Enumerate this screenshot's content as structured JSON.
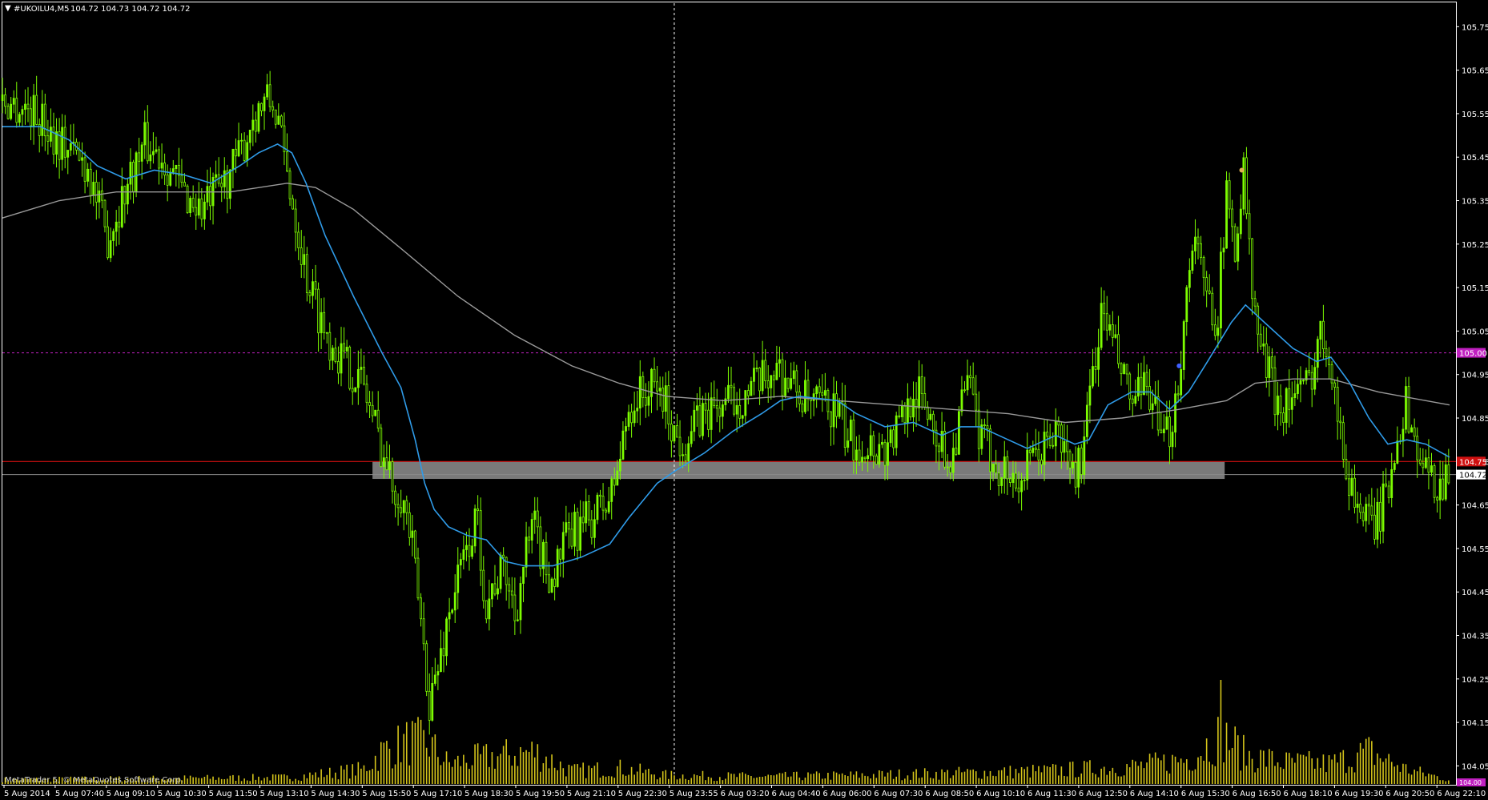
{
  "header": {
    "symbol_line": "#UKOILU4,M5",
    "ohlc": "104.72 104.73 104.72 104.72"
  },
  "footer": {
    "copyright": "MetaTrader 5, © MetaQuotes Software Corp."
  },
  "colors": {
    "background": "#000000",
    "candle": "#7CFC00",
    "volume": "#D4C41A",
    "ma_fast": "#2F9BE8",
    "ma_slow": "#9A9A9A",
    "resistance": "#C020C0",
    "support": "#D01010",
    "zone": "#7A7A7A",
    "bid_line": "#8A8A8A",
    "axis": "#FFFFFF"
  },
  "chart_data": {
    "type": "candlestick",
    "ylim": [
      104.0,
      105.8
    ],
    "y_ticks": [
      "105.75",
      "105.65",
      "105.55",
      "105.45",
      "105.35",
      "105.25",
      "105.15",
      "105.05",
      "104.95",
      "104.85",
      "104.75",
      "104.65",
      "104.55",
      "104.45",
      "104.35",
      "104.25",
      "104.15",
      "104.05"
    ],
    "x_ticks": [
      "5 Aug 2014",
      "5 Aug 07:40",
      "5 Aug 09:10",
      "5 Aug 10:30",
      "5 Aug 11:50",
      "5 Aug 13:10",
      "5 Aug 14:30",
      "5 Aug 15:50",
      "5 Aug 17:10",
      "5 Aug 18:30",
      "5 Aug 19:50",
      "5 Aug 21:10",
      "5 Aug 22:30",
      "5 Aug 23:55",
      "6 Aug 03:20",
      "6 Aug 04:40",
      "6 Aug 06:00",
      "6 Aug 07:30",
      "6 Aug 08:50",
      "6 Aug 10:10",
      "6 Aug 11:30",
      "6 Aug 12:50",
      "6 Aug 14:10",
      "6 Aug 15:30",
      "6 Aug 16:50",
      "6 Aug 18:10",
      "6 Aug 19:30",
      "6 Aug 20:50",
      "6 Aug 22:10"
    ],
    "price_path": [
      [
        0,
        105.58
      ],
      [
        30,
        105.56
      ],
      [
        60,
        105.49
      ],
      [
        90,
        105.43
      ],
      [
        110,
        105.26
      ],
      [
        130,
        105.38
      ],
      [
        150,
        105.48
      ],
      [
        170,
        105.45
      ],
      [
        190,
        105.37
      ],
      [
        210,
        105.33
      ],
      [
        230,
        105.38
      ],
      [
        250,
        105.45
      ],
      [
        265,
        105.55
      ],
      [
        280,
        105.58
      ],
      [
        290,
        105.55
      ],
      [
        295,
        105.46
      ],
      [
        305,
        105.36
      ],
      [
        320,
        105.18
      ],
      [
        340,
        105.05
      ],
      [
        360,
        104.98
      ],
      [
        380,
        104.93
      ],
      [
        400,
        104.78
      ],
      [
        410,
        104.7
      ],
      [
        420,
        104.68
      ],
      [
        430,
        104.58
      ],
      [
        440,
        104.4
      ],
      [
        450,
        104.2
      ],
      [
        460,
        104.28
      ],
      [
        470,
        104.4
      ],
      [
        480,
        104.48
      ],
      [
        490,
        104.55
      ],
      [
        500,
        104.62
      ],
      [
        510,
        104.42
      ],
      [
        520,
        104.48
      ],
      [
        530,
        104.5
      ],
      [
        540,
        104.4
      ],
      [
        550,
        104.52
      ],
      [
        560,
        104.6
      ],
      [
        570,
        104.52
      ],
      [
        580,
        104.48
      ],
      [
        590,
        104.55
      ],
      [
        600,
        104.58
      ],
      [
        620,
        104.62
      ],
      [
        640,
        104.66
      ],
      [
        650,
        104.75
      ],
      [
        660,
        104.87
      ],
      [
        670,
        104.9
      ],
      [
        690,
        104.92
      ],
      [
        700,
        104.88
      ],
      [
        710,
        104.8
      ],
      [
        720,
        104.8
      ],
      [
        740,
        104.86
      ],
      [
        760,
        104.88
      ],
      [
        780,
        104.9
      ],
      [
        800,
        104.93
      ],
      [
        815,
        104.97
      ],
      [
        830,
        104.93
      ],
      [
        850,
        104.88
      ],
      [
        880,
        104.87
      ],
      [
        890,
        104.8
      ],
      [
        910,
        104.79
      ],
      [
        930,
        104.78
      ],
      [
        950,
        104.85
      ],
      [
        960,
        104.92
      ],
      [
        980,
        104.85
      ],
      [
        990,
        104.78
      ],
      [
        1000,
        104.75
      ],
      [
        1010,
        104.88
      ],
      [
        1020,
        104.92
      ],
      [
        1030,
        104.8
      ],
      [
        1050,
        104.74
      ],
      [
        1070,
        104.7
      ],
      [
        1090,
        104.76
      ],
      [
        1110,
        104.82
      ],
      [
        1130,
        104.72
      ],
      [
        1140,
        104.78
      ],
      [
        1150,
        104.98
      ],
      [
        1160,
        105.1
      ],
      [
        1170,
        105.02
      ],
      [
        1190,
        104.88
      ],
      [
        1210,
        104.92
      ],
      [
        1220,
        104.78
      ],
      [
        1230,
        104.82
      ],
      [
        1240,
        104.95
      ],
      [
        1255,
        105.3
      ],
      [
        1265,
        105.15
      ],
      [
        1280,
        105.08
      ],
      [
        1290,
        105.35
      ],
      [
        1300,
        105.25
      ],
      [
        1308,
        105.42
      ],
      [
        1318,
        105.1
      ],
      [
        1330,
        104.98
      ],
      [
        1345,
        104.88
      ],
      [
        1360,
        104.9
      ],
      [
        1375,
        104.92
      ],
      [
        1390,
        105.05
      ],
      [
        1400,
        105.0
      ],
      [
        1410,
        104.8
      ],
      [
        1420,
        104.7
      ],
      [
        1440,
        104.6
      ],
      [
        1450,
        104.62
      ],
      [
        1460,
        104.68
      ],
      [
        1470,
        104.83
      ],
      [
        1480,
        104.88
      ],
      [
        1490,
        104.78
      ],
      [
        1500,
        104.72
      ],
      [
        1510,
        104.7
      ],
      [
        1525,
        104.72
      ]
    ],
    "ma_fast_path": [
      [
        0,
        105.52
      ],
      [
        40,
        105.52
      ],
      [
        70,
        105.49
      ],
      [
        100,
        105.43
      ],
      [
        130,
        105.4
      ],
      [
        160,
        105.42
      ],
      [
        190,
        105.41
      ],
      [
        220,
        105.39
      ],
      [
        250,
        105.43
      ],
      [
        270,
        105.46
      ],
      [
        290,
        105.48
      ],
      [
        305,
        105.46
      ],
      [
        320,
        105.39
      ],
      [
        340,
        105.27
      ],
      [
        370,
        105.13
      ],
      [
        400,
        105.0
      ],
      [
        420,
        104.92
      ],
      [
        435,
        104.8
      ],
      [
        445,
        104.7
      ],
      [
        455,
        104.64
      ],
      [
        470,
        104.6
      ],
      [
        490,
        104.58
      ],
      [
        510,
        104.57
      ],
      [
        530,
        104.52
      ],
      [
        550,
        104.51
      ],
      [
        580,
        104.51
      ],
      [
        610,
        104.53
      ],
      [
        640,
        104.56
      ],
      [
        660,
        104.62
      ],
      [
        690,
        104.7
      ],
      [
        710,
        104.73
      ],
      [
        740,
        104.77
      ],
      [
        770,
        104.82
      ],
      [
        800,
        104.86
      ],
      [
        820,
        104.89
      ],
      [
        840,
        104.9
      ],
      [
        880,
        104.89
      ],
      [
        900,
        104.86
      ],
      [
        930,
        104.83
      ],
      [
        960,
        104.84
      ],
      [
        990,
        104.81
      ],
      [
        1010,
        104.83
      ],
      [
        1030,
        104.83
      ],
      [
        1060,
        104.8
      ],
      [
        1080,
        104.78
      ],
      [
        1110,
        104.81
      ],
      [
        1130,
        104.79
      ],
      [
        1145,
        104.8
      ],
      [
        1165,
        104.88
      ],
      [
        1190,
        104.91
      ],
      [
        1210,
        104.91
      ],
      [
        1230,
        104.87
      ],
      [
        1250,
        104.91
      ],
      [
        1270,
        104.98
      ],
      [
        1295,
        105.07
      ],
      [
        1310,
        105.11
      ],
      [
        1330,
        105.07
      ],
      [
        1360,
        105.01
      ],
      [
        1385,
        104.98
      ],
      [
        1400,
        104.99
      ],
      [
        1420,
        104.93
      ],
      [
        1440,
        104.85
      ],
      [
        1460,
        104.79
      ],
      [
        1480,
        104.8
      ],
      [
        1500,
        104.79
      ],
      [
        1525,
        104.76
      ]
    ],
    "ma_slow_path": [
      [
        0,
        105.31
      ],
      [
        60,
        105.35
      ],
      [
        120,
        105.37
      ],
      [
        180,
        105.37
      ],
      [
        240,
        105.37
      ],
      [
        300,
        105.39
      ],
      [
        330,
        105.38
      ],
      [
        370,
        105.33
      ],
      [
        420,
        105.24
      ],
      [
        480,
        105.13
      ],
      [
        540,
        105.04
      ],
      [
        600,
        104.97
      ],
      [
        650,
        104.93
      ],
      [
        700,
        104.9
      ],
      [
        760,
        104.89
      ],
      [
        820,
        104.9
      ],
      [
        880,
        104.89
      ],
      [
        940,
        104.88
      ],
      [
        1000,
        104.87
      ],
      [
        1060,
        104.86
      ],
      [
        1120,
        104.84
      ],
      [
        1180,
        104.85
      ],
      [
        1240,
        104.87
      ],
      [
        1290,
        104.89
      ],
      [
        1320,
        104.93
      ],
      [
        1360,
        104.94
      ],
      [
        1400,
        104.94
      ],
      [
        1450,
        104.91
      ],
      [
        1500,
        104.89
      ],
      [
        1525,
        104.88
      ]
    ],
    "volume_path": [
      [
        0,
        6
      ],
      [
        300,
        9
      ],
      [
        380,
        20
      ],
      [
        400,
        45
      ],
      [
        430,
        60
      ],
      [
        450,
        55
      ],
      [
        470,
        28
      ],
      [
        500,
        35
      ],
      [
        560,
        45
      ],
      [
        600,
        18
      ],
      [
        650,
        22
      ],
      [
        700,
        12
      ],
      [
        800,
        10
      ],
      [
        900,
        12
      ],
      [
        1000,
        15
      ],
      [
        1100,
        18
      ],
      [
        1200,
        25
      ],
      [
        1250,
        35
      ],
      [
        1285,
        70
      ],
      [
        1310,
        40
      ],
      [
        1350,
        30
      ],
      [
        1400,
        28
      ],
      [
        1440,
        45
      ],
      [
        1480,
        20
      ],
      [
        1525,
        6
      ]
    ],
    "volume_peak_bar": {
      "x": 1284,
      "volume": 130
    },
    "price_levels": {
      "resistance": 105.0,
      "resistance_label": "105.00",
      "support": 104.75,
      "support_label": "104.75",
      "current": 104.72,
      "current_label": "104.72",
      "bottom_label": "104.00"
    },
    "zone": {
      "x_from": 390,
      "x_to": 1288,
      "price_top": 104.75,
      "price_bottom": 104.71
    },
    "crosshair_x": 708,
    "markers": [
      {
        "x": 1240,
        "price": 104.97,
        "color": "#4060FF"
      },
      {
        "x": 1306,
        "price": 105.42,
        "color": "#E0B050"
      }
    ]
  }
}
